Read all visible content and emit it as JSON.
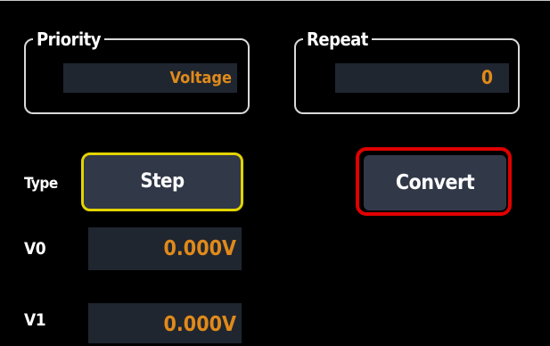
{
  "priority": {
    "legend": "Priority",
    "value": "Voltage"
  },
  "repeat": {
    "legend": "Repeat",
    "value": "0"
  },
  "type": {
    "label": "Type",
    "button": "Step"
  },
  "convert": {
    "label": "Convert"
  },
  "v0": {
    "label": "V0",
    "value": "0.000V"
  },
  "v1": {
    "label": "V1",
    "value": "0.000V"
  },
  "colors": {
    "value_text": "#e08a1a",
    "field_bg": "#202630",
    "button_bg": "#313848",
    "step_border": "#e3d400",
    "convert_highlight": "#e00000"
  }
}
